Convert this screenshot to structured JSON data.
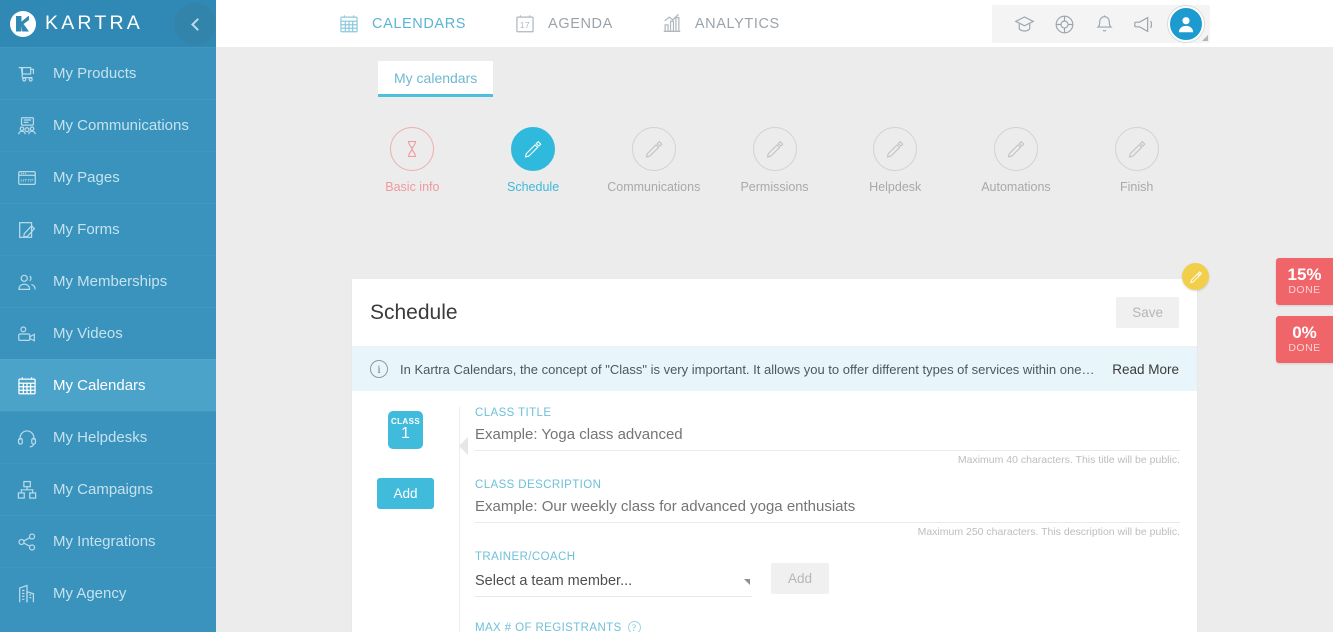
{
  "brand": {
    "logo_text": "KARTRA",
    "accent_blue": "#41bbdc",
    "sidebar_blue": "#3a93bd",
    "danger_red": "#f0656a",
    "edit_yellow": "#f2cf4a"
  },
  "sidebar": {
    "collapse_icon": "chevron-left-icon",
    "items": [
      {
        "label": "My Products",
        "icon": "cart-icon",
        "active": false
      },
      {
        "label": "My Communications",
        "icon": "broadcast-icon",
        "active": false
      },
      {
        "label": "My Pages",
        "icon": "http-page-icon",
        "active": false
      },
      {
        "label": "My Forms",
        "icon": "form-pencil-icon",
        "active": false
      },
      {
        "label": "My Memberships",
        "icon": "members-icon",
        "active": false
      },
      {
        "label": "My Videos",
        "icon": "video-camera-icon",
        "active": false
      },
      {
        "label": "My Calendars",
        "icon": "calendar-icon",
        "active": true
      },
      {
        "label": "My Helpdesks",
        "icon": "headset-icon",
        "active": false
      },
      {
        "label": "My Campaigns",
        "icon": "sitemap-icon",
        "active": false
      },
      {
        "label": "My Integrations",
        "icon": "share-nodes-icon",
        "active": false
      },
      {
        "label": "My Agency",
        "icon": "building-icon",
        "active": false
      }
    ]
  },
  "topbar": {
    "tabs": [
      {
        "label": "CALENDARS",
        "icon": "calendar-grid-icon",
        "active": true
      },
      {
        "label": "AGENDA",
        "icon": "calendar-17-icon",
        "active": false
      },
      {
        "label": "ANALYTICS",
        "icon": "bar-chart-icon",
        "active": false
      }
    ],
    "icons": [
      {
        "name": "graduation-cap-icon"
      },
      {
        "name": "lifebuoy-icon"
      },
      {
        "name": "bell-icon"
      },
      {
        "name": "megaphone-icon"
      }
    ],
    "avatar_icon": "user-avatar-icon"
  },
  "subtab": {
    "label": "My calendars"
  },
  "wizard": {
    "steps": [
      {
        "label": "Basic info",
        "icon": "hourglass-icon",
        "state": "basic"
      },
      {
        "label": "Schedule",
        "icon": "pencil-icon",
        "state": "current"
      },
      {
        "label": "Communications",
        "icon": "pencil-icon",
        "state": "pending"
      },
      {
        "label": "Permissions",
        "icon": "pencil-icon",
        "state": "pending"
      },
      {
        "label": "Helpdesk",
        "icon": "pencil-icon",
        "state": "pending"
      },
      {
        "label": "Automations",
        "icon": "pencil-icon",
        "state": "pending"
      },
      {
        "label": "Finish",
        "icon": "pencil-icon",
        "state": "pending"
      }
    ]
  },
  "panel": {
    "title": "Schedule",
    "save_label": "Save",
    "banner": {
      "icon": "info-icon",
      "text": "In Kartra Calendars, the concept of \"Class\" is very important. It allows you to offer different types of services within one singl...",
      "read_more": "Read More"
    },
    "class_chip": {
      "top": "CLASS",
      "number": "1"
    },
    "add_class_label": "Add",
    "fields": {
      "class_title": {
        "label": "CLASS TITLE",
        "value": "",
        "placeholder": "Example: Yoga class advanced",
        "hint": "Maximum 40 characters. This title will be public."
      },
      "class_description": {
        "label": "CLASS DESCRIPTION",
        "value": "",
        "placeholder": "Example: Our weekly class for advanced yoga enthusiats",
        "hint": "Maximum 250 characters. This description will be public."
      },
      "trainer": {
        "label": "TRAINER/COACH",
        "selected": "Select a team member...",
        "options": [
          "Select a team member..."
        ],
        "add_label": "Add"
      },
      "max_registrants": {
        "label": "MAX # OF REGISTRANTS",
        "info_icon": "question-icon"
      }
    },
    "edit_fab_icon": "pencil-icon"
  },
  "badges": [
    {
      "pct": "15%",
      "done": "DONE"
    },
    {
      "pct": "0%",
      "done": "DONE"
    }
  ]
}
